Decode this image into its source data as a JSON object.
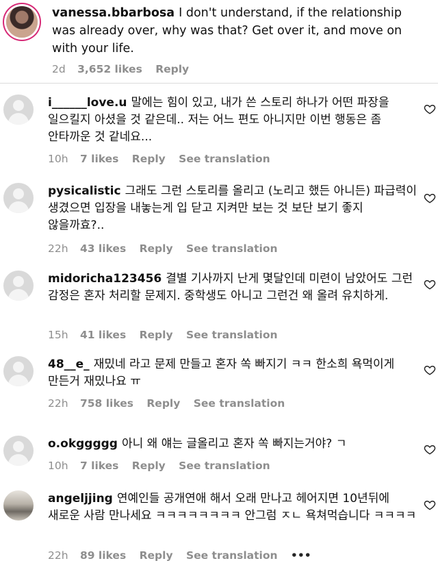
{
  "comments": [
    {
      "username": "vanessa.bbarbosa",
      "text": "I don't understand, if the relationship was already over, why was that? Get over it, and move on with your life.",
      "time": "2d",
      "likes": "3,652 likes",
      "reply": "Reply"
    },
    {
      "username": "i______love.u",
      "text": "말에는 힘이 있고, 내가 쓴 스토리 하나가 어떤 파장을 일으킬지 아셨을 것 같은데.. 저는 어느 편도 아니지만 이번 행동은 좀 안타까운 것 같네요...",
      "time": "10h",
      "likes": "7 likes",
      "reply": "Reply",
      "translate": "See translation"
    },
    {
      "username": "pysicalistic",
      "text": "그래도 그런 스토리를 올리고 (노리고 했든 아니든) 파급력이 생겼으면 입장을 내놓는게 입 닫고 지켜만 보는 것 보단 보기 좋지 않을까효?..",
      "time": "22h",
      "likes": "43 likes",
      "reply": "Reply",
      "translate": "See translation"
    },
    {
      "username": "midoricha123456",
      "text": "결별 기사까지 난게 몇달인데 미련이 남았어도 그런 감정은 혼자 처리할 문제지. 중학생도 아니고 그런건 왜 올려 유치하게.",
      "time": "15h",
      "likes": "41 likes",
      "reply": "Reply",
      "translate": "See translation"
    },
    {
      "username": "48__e_",
      "text": "재밌네 라고 문제 만들고 혼자 쏙 빠지기 ㅋㅋ 한소희 욕먹이게 만든거 재밌나요 ㅠ",
      "time": "22h",
      "likes": "758 likes",
      "reply": "Reply",
      "translate": "See translation"
    },
    {
      "username": "o.okggggg",
      "text": "아니 왜 얘는 글올리고 혼자 쏙 빠지는거야? ㄱ",
      "time": "10h",
      "likes": "7 likes",
      "reply": "Reply",
      "translate": "See translation"
    },
    {
      "username": "angeljjing",
      "text": "연예인들 공개연애 해서 오래 만나고 헤어지면 10년뒤에 새로운 사람 만나세요 ㅋㅋㅋㅋㅋㅋㅋㅋ 안그럼 ㅈㄴ 욕쳐먹습니다 ㅋㅋㅋㅋ",
      "time": "22h",
      "likes": "89 likes",
      "reply": "Reply",
      "translate": "See translation",
      "more": "•••"
    }
  ]
}
